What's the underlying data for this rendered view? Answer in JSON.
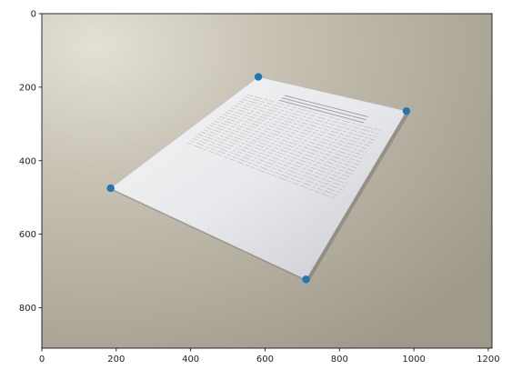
{
  "chart_data": {
    "type": "scatter",
    "title": "",
    "xlabel": "",
    "ylabel": "",
    "xlim": [
      0,
      1210
    ],
    "ylim": [
      910,
      0
    ],
    "y_inverted": true,
    "grid": false,
    "x_ticks": [
      0,
      200,
      400,
      600,
      800,
      1000,
      1200
    ],
    "y_ticks": [
      0,
      200,
      400,
      600,
      800
    ],
    "background_image": "photo of a printed document page lying on a table",
    "series": [
      {
        "color": "#1f77b4",
        "marker": "circle",
        "points": [
          {
            "x": 582,
            "y": 172
          },
          {
            "x": 980,
            "y": 265
          },
          {
            "x": 710,
            "y": 723
          },
          {
            "x": 185,
            "y": 475
          }
        ]
      }
    ]
  }
}
